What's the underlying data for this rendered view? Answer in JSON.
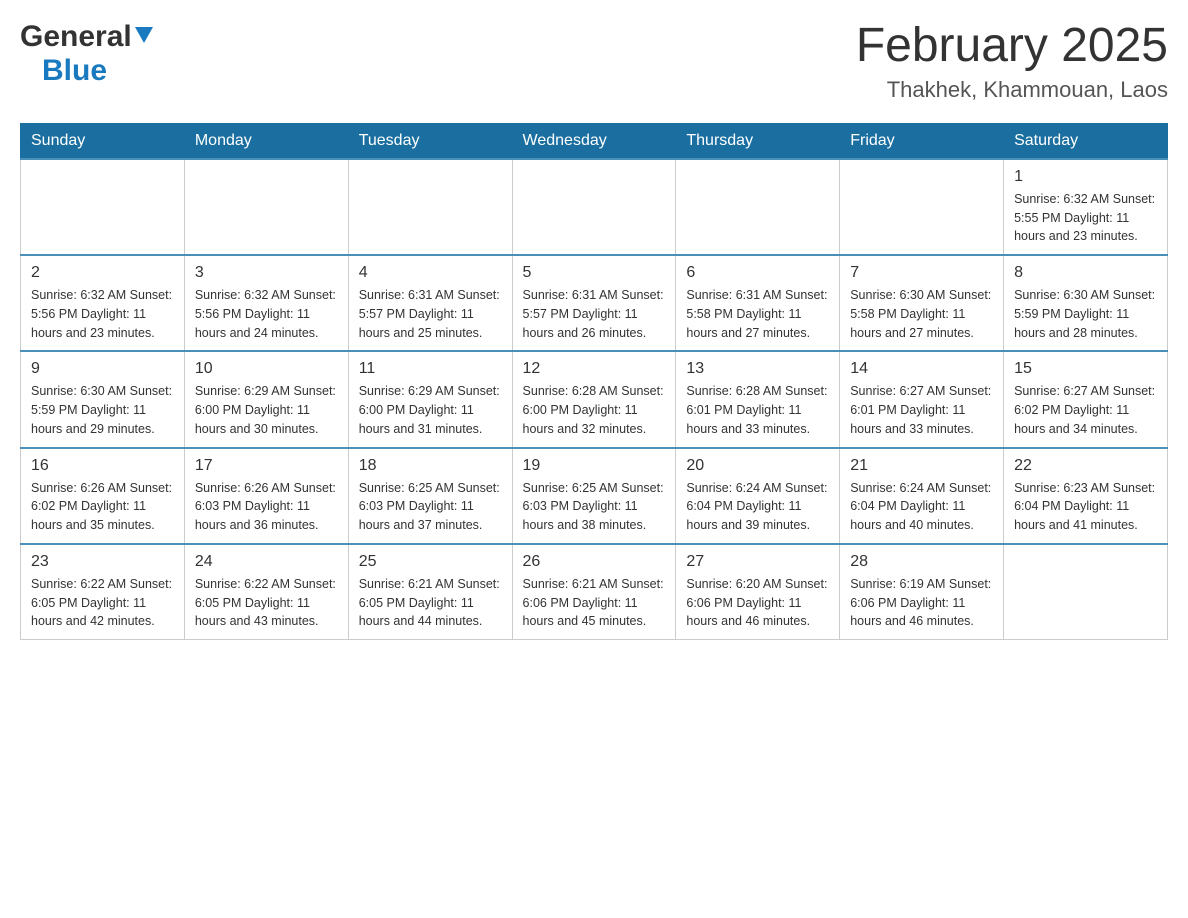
{
  "header": {
    "logo_general": "General",
    "logo_blue": "Blue",
    "title": "February 2025",
    "location": "Thakhek, Khammouan, Laos"
  },
  "days_of_week": [
    "Sunday",
    "Monday",
    "Tuesday",
    "Wednesday",
    "Thursday",
    "Friday",
    "Saturday"
  ],
  "weeks": [
    {
      "days": [
        {
          "number": "",
          "info": ""
        },
        {
          "number": "",
          "info": ""
        },
        {
          "number": "",
          "info": ""
        },
        {
          "number": "",
          "info": ""
        },
        {
          "number": "",
          "info": ""
        },
        {
          "number": "",
          "info": ""
        },
        {
          "number": "1",
          "info": "Sunrise: 6:32 AM\nSunset: 5:55 PM\nDaylight: 11 hours and 23 minutes."
        }
      ]
    },
    {
      "days": [
        {
          "number": "2",
          "info": "Sunrise: 6:32 AM\nSunset: 5:56 PM\nDaylight: 11 hours and 23 minutes."
        },
        {
          "number": "3",
          "info": "Sunrise: 6:32 AM\nSunset: 5:56 PM\nDaylight: 11 hours and 24 minutes."
        },
        {
          "number": "4",
          "info": "Sunrise: 6:31 AM\nSunset: 5:57 PM\nDaylight: 11 hours and 25 minutes."
        },
        {
          "number": "5",
          "info": "Sunrise: 6:31 AM\nSunset: 5:57 PM\nDaylight: 11 hours and 26 minutes."
        },
        {
          "number": "6",
          "info": "Sunrise: 6:31 AM\nSunset: 5:58 PM\nDaylight: 11 hours and 27 minutes."
        },
        {
          "number": "7",
          "info": "Sunrise: 6:30 AM\nSunset: 5:58 PM\nDaylight: 11 hours and 27 minutes."
        },
        {
          "number": "8",
          "info": "Sunrise: 6:30 AM\nSunset: 5:59 PM\nDaylight: 11 hours and 28 minutes."
        }
      ]
    },
    {
      "days": [
        {
          "number": "9",
          "info": "Sunrise: 6:30 AM\nSunset: 5:59 PM\nDaylight: 11 hours and 29 minutes."
        },
        {
          "number": "10",
          "info": "Sunrise: 6:29 AM\nSunset: 6:00 PM\nDaylight: 11 hours and 30 minutes."
        },
        {
          "number": "11",
          "info": "Sunrise: 6:29 AM\nSunset: 6:00 PM\nDaylight: 11 hours and 31 minutes."
        },
        {
          "number": "12",
          "info": "Sunrise: 6:28 AM\nSunset: 6:00 PM\nDaylight: 11 hours and 32 minutes."
        },
        {
          "number": "13",
          "info": "Sunrise: 6:28 AM\nSunset: 6:01 PM\nDaylight: 11 hours and 33 minutes."
        },
        {
          "number": "14",
          "info": "Sunrise: 6:27 AM\nSunset: 6:01 PM\nDaylight: 11 hours and 33 minutes."
        },
        {
          "number": "15",
          "info": "Sunrise: 6:27 AM\nSunset: 6:02 PM\nDaylight: 11 hours and 34 minutes."
        }
      ]
    },
    {
      "days": [
        {
          "number": "16",
          "info": "Sunrise: 6:26 AM\nSunset: 6:02 PM\nDaylight: 11 hours and 35 minutes."
        },
        {
          "number": "17",
          "info": "Sunrise: 6:26 AM\nSunset: 6:03 PM\nDaylight: 11 hours and 36 minutes."
        },
        {
          "number": "18",
          "info": "Sunrise: 6:25 AM\nSunset: 6:03 PM\nDaylight: 11 hours and 37 minutes."
        },
        {
          "number": "19",
          "info": "Sunrise: 6:25 AM\nSunset: 6:03 PM\nDaylight: 11 hours and 38 minutes."
        },
        {
          "number": "20",
          "info": "Sunrise: 6:24 AM\nSunset: 6:04 PM\nDaylight: 11 hours and 39 minutes."
        },
        {
          "number": "21",
          "info": "Sunrise: 6:24 AM\nSunset: 6:04 PM\nDaylight: 11 hours and 40 minutes."
        },
        {
          "number": "22",
          "info": "Sunrise: 6:23 AM\nSunset: 6:04 PM\nDaylight: 11 hours and 41 minutes."
        }
      ]
    },
    {
      "days": [
        {
          "number": "23",
          "info": "Sunrise: 6:22 AM\nSunset: 6:05 PM\nDaylight: 11 hours and 42 minutes."
        },
        {
          "number": "24",
          "info": "Sunrise: 6:22 AM\nSunset: 6:05 PM\nDaylight: 11 hours and 43 minutes."
        },
        {
          "number": "25",
          "info": "Sunrise: 6:21 AM\nSunset: 6:05 PM\nDaylight: 11 hours and 44 minutes."
        },
        {
          "number": "26",
          "info": "Sunrise: 6:21 AM\nSunset: 6:06 PM\nDaylight: 11 hours and 45 minutes."
        },
        {
          "number": "27",
          "info": "Sunrise: 6:20 AM\nSunset: 6:06 PM\nDaylight: 11 hours and 46 minutes."
        },
        {
          "number": "28",
          "info": "Sunrise: 6:19 AM\nSunset: 6:06 PM\nDaylight: 11 hours and 46 minutes."
        },
        {
          "number": "",
          "info": ""
        }
      ]
    }
  ]
}
